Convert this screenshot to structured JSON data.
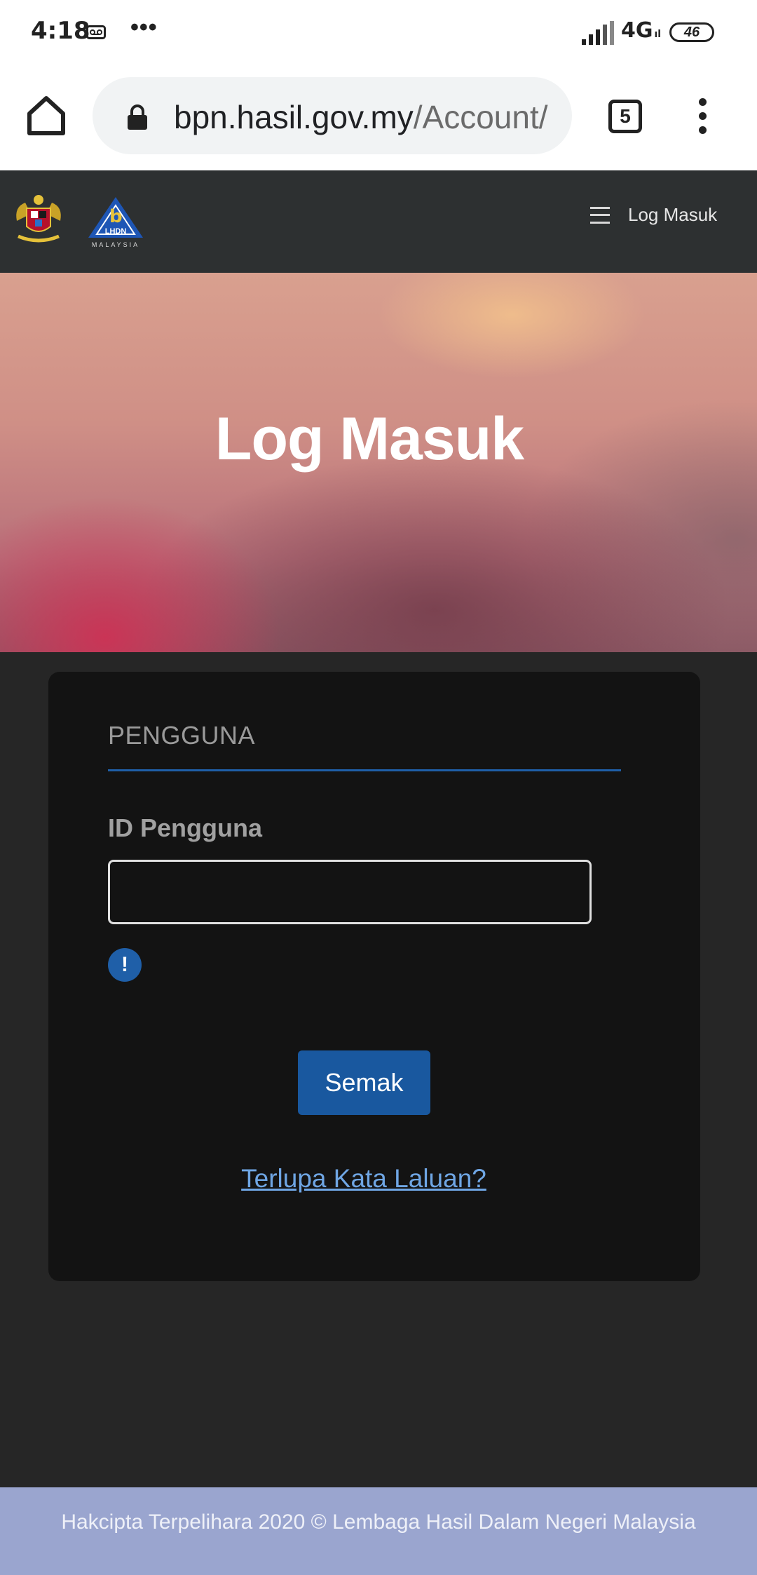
{
  "status_bar": {
    "time": "4:18",
    "more_indicator": "•••",
    "network": "4G",
    "network_sub": "ıl",
    "battery": "46"
  },
  "browser": {
    "url_domain": "bpn.hasil.gov.my",
    "url_path": "/Account/",
    "tab_count": "5"
  },
  "site_nav": {
    "menu_label": "Log Masuk"
  },
  "hero": {
    "title": "Log Masuk"
  },
  "login": {
    "tab_label": "PENGGUNA",
    "id_label": "ID Pengguna",
    "id_value": "",
    "info_icon": "!",
    "submit_label": "Semak",
    "forgot_label": "Terlupa Kata Laluan?"
  },
  "footer": {
    "copyright": "Hakcipta Terpelihara 2020 © Lembaga Hasil Dalam Negeri Malaysia"
  },
  "colors": {
    "nav_bg": "#2d3031",
    "card_bg": "#131313",
    "accent": "#1f5fa8",
    "link": "#6fa6e4",
    "footer_bg": "#9aa5cf"
  }
}
